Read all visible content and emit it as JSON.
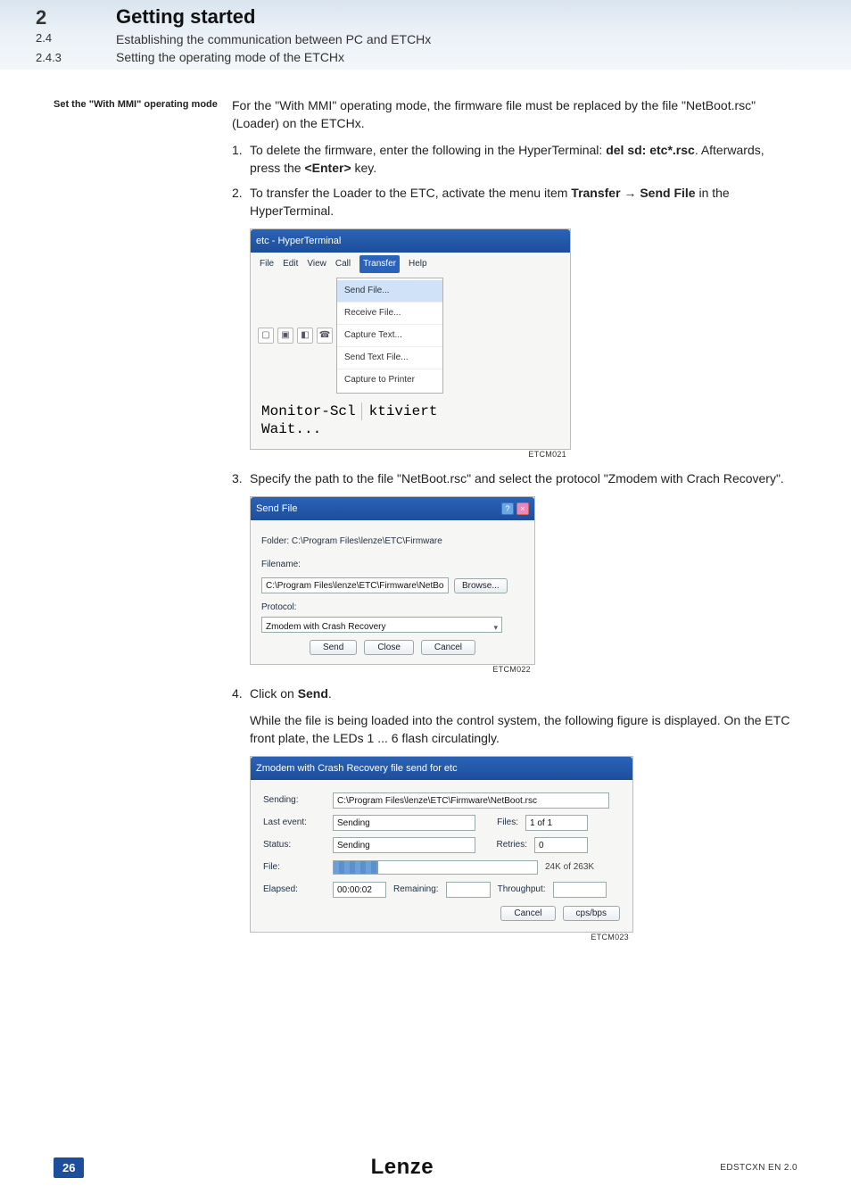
{
  "header": {
    "chapter_num": "2",
    "section_num": "2.4",
    "subsection_num": "2.4.3",
    "chapter_title": "Getting started",
    "section_title": "Establishing the communication between PC and ETCHx",
    "subsection_title": "Setting the operating mode of the ETCHx"
  },
  "margin_note": "Set the \"With MMI\" operating mode",
  "intro": "For the \"With MMI\" operating mode, the firmware file must be replaced by the file \"NetBoot.rsc\" (Loader) on the ETCHx.",
  "steps": {
    "s1_num": "1.",
    "s1_a": "To delete the firmware, enter the following in the HyperTerminal: ",
    "s1_b": "del sd: etc*.rsc",
    "s1_c": ". Afterwards, press the ",
    "s1_d": "<Enter>",
    "s1_e": " key.",
    "s2_num": "2.",
    "s2_a": "To transfer the Loader to the ETC, activate the menu item ",
    "s2_b": "Transfer",
    "s2_arrow": " → ",
    "s2_c": "Send File",
    "s2_d": " in the HyperTerminal.",
    "s3_num": "3.",
    "s3_txt": "Specify the path to the file \"NetBoot.rsc\" and select the protocol \"Zmodem with Crach Recovery\".",
    "s4_num": "4.",
    "s4_a": "Click on ",
    "s4_b": "Send",
    "s4_c": ".",
    "s4_follow": "While the file is being loaded into the control system, the following figure is displayed. On the ETC front plate, the LEDs 1 ... 6 flash circulatingly."
  },
  "shot1": {
    "title": "etc - HyperTerminal",
    "menu_file": "File",
    "menu_edit": "Edit",
    "menu_view": "View",
    "menu_call": "Call",
    "menu_transfer": "Transfer",
    "menu_help": "Help",
    "dd_send": "Send File...",
    "dd_recv": "Receive File...",
    "dd_cap": "Capture Text...",
    "dd_sendtext": "Send Text File...",
    "dd_captoprn": "Capture to Printer",
    "mono_left": "Monitor-Scl",
    "mono_right": "ktiviert",
    "mono_bottom": "Wait...",
    "caption": "ETCM021"
  },
  "shot2": {
    "title": "Send File",
    "folder_lbl": "Folder: C:\\Program Files\\lenze\\ETC\\Firmware",
    "filename_lbl": "Filename:",
    "filename_val": "C:\\Program Files\\lenze\\ETC\\Firmware\\NetBoot.",
    "browse": "Browse...",
    "protocol_lbl": "Protocol:",
    "protocol_val": "Zmodem with Crash Recovery",
    "btn_send": "Send",
    "btn_close": "Close",
    "btn_cancel": "Cancel",
    "caption": "ETCM022"
  },
  "shot3": {
    "title": "Zmodem with Crash Recovery file send for etc",
    "sending_lbl": "Sending:",
    "sending_val": "C:\\Program Files\\lenze\\ETC\\Firmware\\NetBoot.rsc",
    "lastevent_lbl": "Last event:",
    "lastevent_val": "Sending",
    "files_lbl": "Files:",
    "files_val": "1 of 1",
    "status_lbl": "Status:",
    "status_val": "Sending",
    "retries_lbl": "Retries:",
    "retries_val": "0",
    "file_lbl": "File:",
    "file_right": "24K of 263K",
    "elapsed_lbl": "Elapsed:",
    "elapsed_val": "00:00:02",
    "remaining_lbl": "Remaining:",
    "throughput_lbl": "Throughput:",
    "btn_cancel": "Cancel",
    "btn_cps": "cps/bps",
    "caption": "ETCM023"
  },
  "footer": {
    "page": "26",
    "brand": "Lenze",
    "doccode": "EDSTCXN EN 2.0"
  }
}
